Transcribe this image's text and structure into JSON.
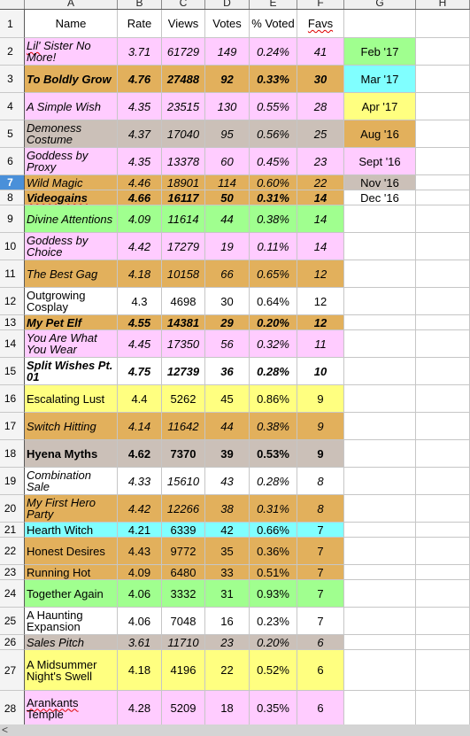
{
  "columns": [
    "A",
    "B",
    "C",
    "D",
    "E",
    "F",
    "G",
    "H"
  ],
  "header_row": {
    "num": "1",
    "name": "Name",
    "rate": "Rate",
    "views": "Views",
    "votes": "Votes",
    "pct": "% Voted",
    "favs": "Favs"
  },
  "colors": {
    "pink": "#ffccff",
    "orange": "#e2b05c",
    "gray": "#cbc0b8",
    "green": "#a0ff8f",
    "cyan": "#80ffff",
    "yellow": "#ffff80",
    "white": "#ffffff"
  },
  "rows": [
    {
      "num": "2",
      "name": "Lil' Sister No More!",
      "rate": "3.71",
      "views": "61729",
      "votes": "149",
      "pct": "0.24%",
      "favs": "41",
      "color": "pink",
      "style": "it",
      "legend": "Feb '17",
      "legend_color": "green"
    },
    {
      "num": "3",
      "name": "To Boldly Grow",
      "rate": "4.76",
      "views": "27488",
      "votes": "92",
      "pct": "0.33%",
      "favs": "30",
      "color": "orange",
      "style": "it bd",
      "legend": "Mar '17",
      "legend_color": "cyan"
    },
    {
      "num": "4",
      "name": "A Simple Wish",
      "rate": "4.35",
      "views": "23515",
      "votes": "130",
      "pct": "0.55%",
      "favs": "28",
      "color": "pink",
      "style": "it",
      "legend": "Apr '17",
      "legend_color": "yellow"
    },
    {
      "num": "5",
      "name": "Demoness Costume",
      "rate": "4.37",
      "views": "17040",
      "votes": "95",
      "pct": "0.56%",
      "favs": "25",
      "color": "gray",
      "style": "it",
      "legend": "Aug '16",
      "legend_color": "orange"
    },
    {
      "num": "6",
      "name": "Goddess by Proxy",
      "rate": "4.35",
      "views": "13378",
      "votes": "60",
      "pct": "0.45%",
      "favs": "23",
      "color": "pink",
      "style": "it",
      "legend": "Sept '16",
      "legend_color": "pink"
    },
    {
      "num": "7",
      "name": "Wild Magic",
      "rate": "4.46",
      "views": "18901",
      "votes": "114",
      "pct": "0.60%",
      "favs": "22",
      "color": "orange",
      "style": "it",
      "legend": "Nov '16",
      "legend_color": "gray",
      "selected": true
    },
    {
      "num": "8",
      "name": "Videogains",
      "rate": "4.66",
      "views": "16117",
      "votes": "50",
      "pct": "0.31%",
      "favs": "14",
      "color": "orange",
      "style": "it bd",
      "legend": "Dec '16",
      "legend_color": "white"
    },
    {
      "num": "9",
      "name": "Divine Attentions",
      "rate": "4.09",
      "views": "11614",
      "votes": "44",
      "pct": "0.38%",
      "favs": "14",
      "color": "green",
      "style": "it"
    },
    {
      "num": "10",
      "name": "Goddess by Choice",
      "rate": "4.42",
      "views": "17279",
      "votes": "19",
      "pct": "0.11%",
      "favs": "14",
      "color": "pink",
      "style": "it"
    },
    {
      "num": "11",
      "name": "The Best Gag",
      "rate": "4.18",
      "views": "10158",
      "votes": "66",
      "pct": "0.65%",
      "favs": "12",
      "color": "orange",
      "style": "it"
    },
    {
      "num": "12",
      "name": "Outgrowing Cosplay",
      "rate": "4.3",
      "views": "4698",
      "votes": "30",
      "pct": "0.64%",
      "favs": "12",
      "color": "white",
      "style": ""
    },
    {
      "num": "13",
      "name": "My Pet Elf",
      "rate": "4.55",
      "views": "14381",
      "votes": "29",
      "pct": "0.20%",
      "favs": "12",
      "color": "orange",
      "style": "it bd"
    },
    {
      "num": "14",
      "name": "You Are What You Wear",
      "rate": "4.45",
      "views": "17350",
      "votes": "56",
      "pct": "0.32%",
      "favs": "11",
      "color": "pink",
      "style": "it"
    },
    {
      "num": "15",
      "name": "Split Wishes Pt. 01",
      "rate": "4.75",
      "views": "12739",
      "votes": "36",
      "pct": "0.28%",
      "favs": "10",
      "color": "white",
      "style": "it bd"
    },
    {
      "num": "16",
      "name": "Escalating Lust",
      "rate": "4.4",
      "views": "5262",
      "votes": "45",
      "pct": "0.86%",
      "favs": "9",
      "color": "yellow",
      "style": ""
    },
    {
      "num": "17",
      "name": "Switch Hitting",
      "rate": "4.14",
      "views": "11642",
      "votes": "44",
      "pct": "0.38%",
      "favs": "9",
      "color": "orange",
      "style": "it"
    },
    {
      "num": "18",
      "name": "Hyena Myths",
      "rate": "4.62",
      "views": "7370",
      "votes": "39",
      "pct": "0.53%",
      "favs": "9",
      "color": "gray",
      "style": "bd"
    },
    {
      "num": "19",
      "name": "Combination Sale",
      "rate": "4.33",
      "views": "15610",
      "votes": "43",
      "pct": "0.28%",
      "favs": "8",
      "color": "white",
      "style": "it"
    },
    {
      "num": "20",
      "name": "My First Hero Party",
      "rate": "4.42",
      "views": "12266",
      "votes": "38",
      "pct": "0.31%",
      "favs": "8",
      "color": "orange",
      "style": "it"
    },
    {
      "num": "21",
      "name": "Hearth Witch",
      "rate": "4.21",
      "views": "6339",
      "votes": "42",
      "pct": "0.66%",
      "favs": "7",
      "color": "cyan",
      "style": ""
    },
    {
      "num": "22",
      "name": "Honest Desires",
      "rate": "4.43",
      "views": "9772",
      "votes": "35",
      "pct": "0.36%",
      "favs": "7",
      "color": "orange",
      "style": ""
    },
    {
      "num": "23",
      "name": "Running Hot",
      "rate": "4.09",
      "views": "6480",
      "votes": "33",
      "pct": "0.51%",
      "favs": "7",
      "color": "orange",
      "style": ""
    },
    {
      "num": "24",
      "name": "Together Again",
      "rate": "4.06",
      "views": "3332",
      "votes": "31",
      "pct": "0.93%",
      "favs": "7",
      "color": "green",
      "style": ""
    },
    {
      "num": "25",
      "name": "A Haunting Expansion",
      "rate": "4.06",
      "views": "7048",
      "votes": "16",
      "pct": "0.23%",
      "favs": "7",
      "color": "white",
      "style": ""
    },
    {
      "num": "26",
      "name": "Sales Pitch",
      "rate": "3.61",
      "views": "11710",
      "votes": "23",
      "pct": "0.20%",
      "favs": "6",
      "color": "gray",
      "style": "it"
    },
    {
      "num": "27",
      "name": "A Midsummer Night's Swell",
      "rate": "4.18",
      "views": "4196",
      "votes": "22",
      "pct": "0.52%",
      "favs": "6",
      "color": "yellow",
      "style": ""
    },
    {
      "num": "28",
      "name": "Arankants Temple",
      "rate": "4.28",
      "views": "5209",
      "votes": "18",
      "pct": "0.35%",
      "favs": "6",
      "color": "pink",
      "style": ""
    }
  ],
  "spellcheck_words": [
    "Lil'",
    "Videogains",
    "Arankants",
    "Favs"
  ],
  "scrollbar": {
    "left_arrow": "<"
  }
}
